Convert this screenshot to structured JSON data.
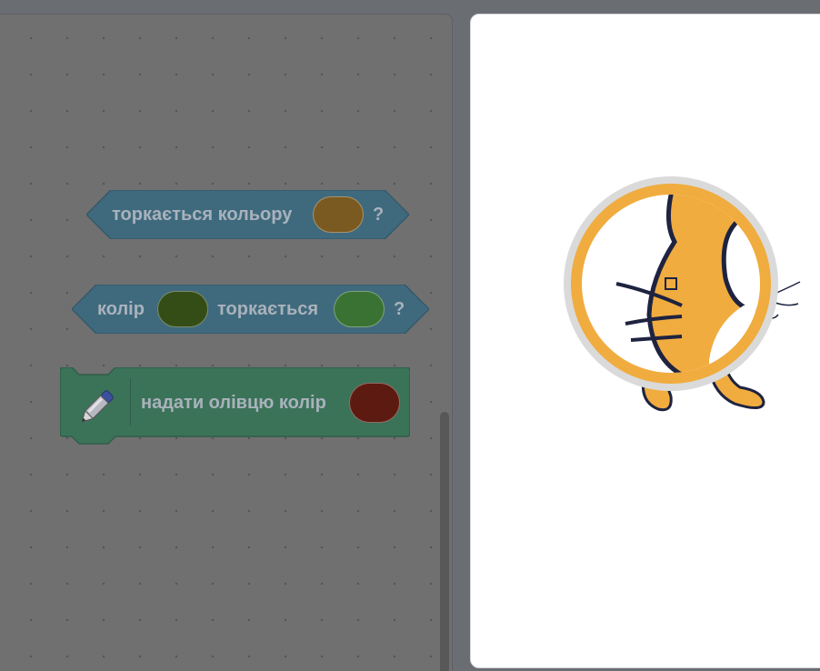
{
  "editor": {
    "blocks": [
      {
        "type": "sensing-boolean",
        "label": "торкається кольору",
        "suffix": "?",
        "colors": [
          "#7a5a20"
        ]
      },
      {
        "type": "sensing-boolean",
        "label_before": "колір",
        "label_middle": "торкається",
        "suffix": "?",
        "colors": [
          "#344d17",
          "#3a7234"
        ]
      },
      {
        "type": "pen-command",
        "label": "надати олівцю колір",
        "icon": "pen-icon",
        "colors": [
          "#5c1a10"
        ]
      }
    ],
    "theme": {
      "sensing_block": "#3f6a7d",
      "pen_block": "#3b7359",
      "workspace": "#707070"
    }
  },
  "stage": {
    "sprite": "cat-sprite",
    "overlay": "color-picker-magnifier",
    "magnifier_color": "#f0ac3f",
    "background": "#ffffff"
  }
}
